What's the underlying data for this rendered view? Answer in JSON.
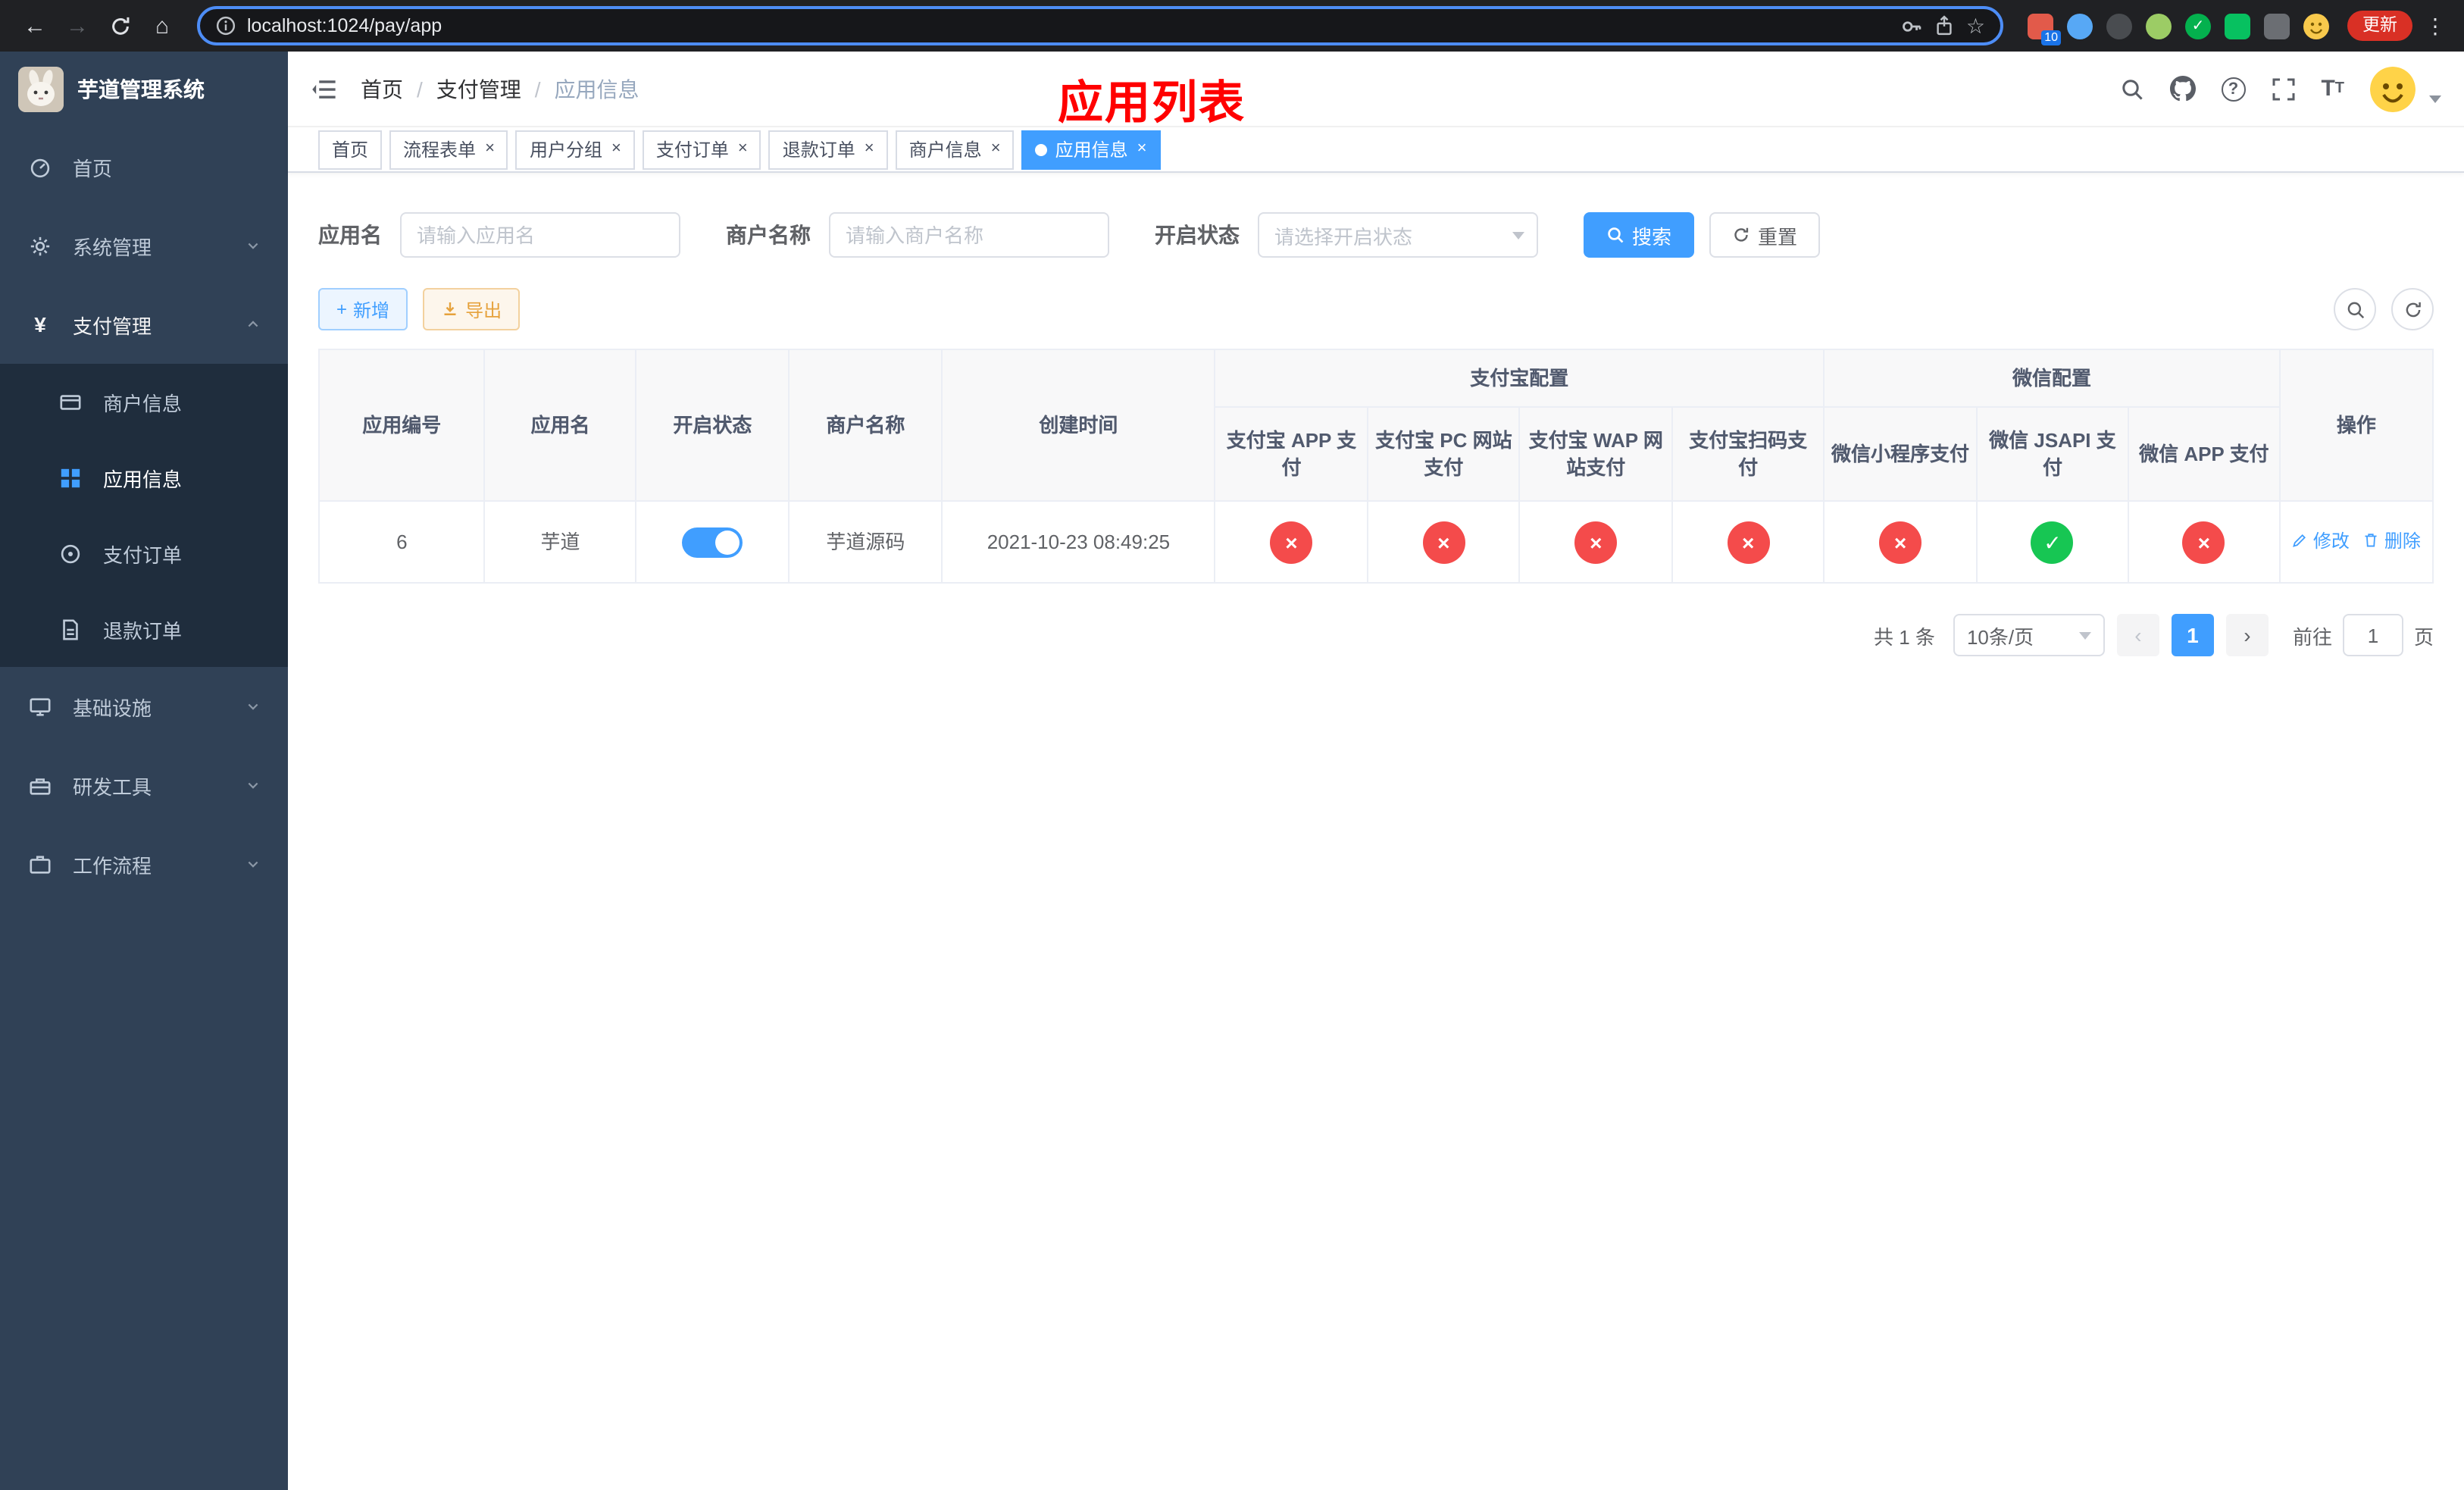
{
  "browser": {
    "url": "localhost:1024/pay/app",
    "update_label": "更新",
    "extension_badge": "10"
  },
  "icons": {
    "back": "←",
    "forward": "→",
    "home": "⌂",
    "star": "☆",
    "kebab": "⋮",
    "check": "✓",
    "cross": "×",
    "prev": "‹",
    "next": "›",
    "plus": "+",
    "yen": "¥",
    "question": "?",
    "font_big": "T",
    "font_small": "T"
  },
  "sidebar": {
    "title": "芋道管理系统",
    "items": [
      {
        "label": "首页"
      },
      {
        "label": "系统管理"
      },
      {
        "label": "支付管理"
      },
      {
        "label": "基础设施"
      },
      {
        "label": "研发工具"
      },
      {
        "label": "工作流程"
      }
    ],
    "submenu": [
      {
        "label": "商户信息"
      },
      {
        "label": "应用信息"
      },
      {
        "label": "支付订单"
      },
      {
        "label": "退款订单"
      }
    ]
  },
  "header": {
    "breadcrumb": [
      "首页",
      "支付管理",
      "应用信息"
    ],
    "separator": "/",
    "annotation": "应用列表"
  },
  "tabs": [
    {
      "label": "首页"
    },
    {
      "label": "流程表单"
    },
    {
      "label": "用户分组"
    },
    {
      "label": "支付订单"
    },
    {
      "label": "退款订单"
    },
    {
      "label": "商户信息"
    },
    {
      "label": "应用信息"
    }
  ],
  "filters": {
    "app_name_label": "应用名",
    "app_name_placeholder": "请输入应用名",
    "merchant_label": "商户名称",
    "merchant_placeholder": "请输入商户名称",
    "status_label": "开启状态",
    "status_placeholder": "请选择开启状态",
    "search_label": "搜索",
    "reset_label": "重置"
  },
  "toolbar": {
    "add_label": "新增",
    "export_label": "导出"
  },
  "table": {
    "columns": [
      "应用编号",
      "应用名",
      "开启状态",
      "商户名称",
      "创建时间"
    ],
    "groups": [
      {
        "title": "支付宝配置",
        "columns": [
          "支付宝 APP 支付",
          "支付宝 PC 网站支付",
          "支付宝 WAP 网站支付",
          "支付宝扫码支付"
        ]
      },
      {
        "title": "微信配置",
        "columns": [
          "微信小程序支付",
          "微信 JSAPI 支付",
          "微信 APP 支付"
        ]
      }
    ],
    "action_column": "操作",
    "rows": [
      {
        "id": "6",
        "name": "芋道",
        "enabled": true,
        "merchant": "芋道源码",
        "created_at": "2021-10-23 08:49:25",
        "alipay_app": false,
        "alipay_pc": false,
        "alipay_wap": false,
        "alipay_qr": false,
        "wx_mini": false,
        "wx_jsapi": true,
        "wx_app": false,
        "edit_label": "修改",
        "delete_label": "删除"
      }
    ]
  },
  "pagination": {
    "total_text": "共 1 条",
    "page_size": "10条/页",
    "current_page": "1",
    "goto_prefix": "前往",
    "goto_value": "1",
    "goto_suffix": "页"
  },
  "colors": {
    "primary": "#409eff",
    "danger": "#f44b4b",
    "success": "#17c653",
    "annotation": "#ff0000",
    "sidebar_bg": "#304156",
    "submenu_bg": "#1f2d3d"
  }
}
